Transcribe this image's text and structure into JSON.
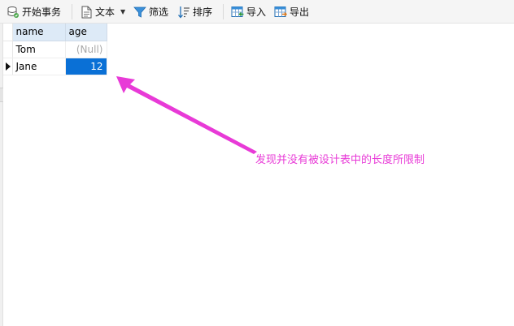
{
  "toolbar": {
    "begin_transaction": "开始事务",
    "text": "文本",
    "filter": "筛选",
    "sort": "排序",
    "import": "导入",
    "export": "导出"
  },
  "table": {
    "columns": [
      "name",
      "age"
    ],
    "rows": [
      {
        "name": "Tom",
        "age": "(Null)"
      },
      {
        "name": "Jane",
        "age": "12"
      }
    ],
    "selected_row": 1,
    "selected_column": "age"
  },
  "annotation": {
    "text": "发现并没有被设计表中的长度所限制",
    "color": "#e83ad7"
  },
  "colors": {
    "header_bg": "#ddeaf7",
    "selection": "#0a70d6",
    "null_text": "#a9a9a9"
  },
  "icons": [
    "database-transaction-icon",
    "document-icon",
    "filter-funnel-icon",
    "sort-icon",
    "import-table-icon",
    "export-table-icon",
    "current-row-pointer-icon",
    "annotation-arrow-icon"
  ]
}
